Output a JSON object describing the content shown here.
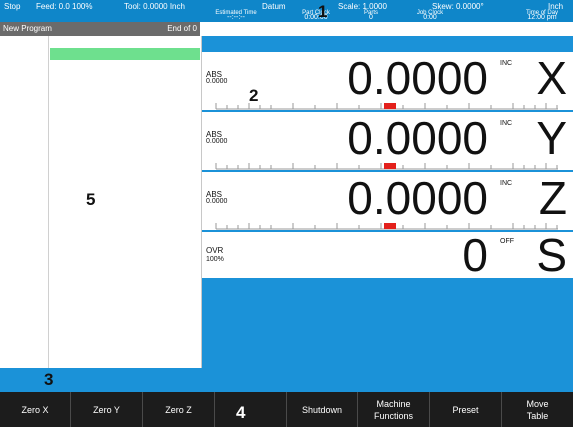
{
  "status_bar": {
    "state": "Stop",
    "feed": "Feed: 0.0 100%",
    "tool": "Tool: 0.0000 Inch",
    "datum": "Datum",
    "scale": "Scale: 1.0000",
    "skew": "Skew: 0.0000°",
    "units": "Inch",
    "clocks": [
      {
        "label": "Estimated Time",
        "value": "--:--:--"
      },
      {
        "label": "Part Clock",
        "value": "0:00:00"
      },
      {
        "label": "Parts",
        "value": "0"
      },
      {
        "label": "Job Clock",
        "value": "0:00"
      },
      {
        "label": "Time of Day",
        "value": "12:00 pm"
      }
    ]
  },
  "program": {
    "name": "New Program",
    "end": "End of 0"
  },
  "axes": [
    {
      "mode": "ABS",
      "mode_value": "0.0000",
      "readout": "0.0000",
      "inc": "INC",
      "letter": "X"
    },
    {
      "mode": "ABS",
      "mode_value": "0.0000",
      "readout": "0.0000",
      "inc": "INC",
      "letter": "Y"
    },
    {
      "mode": "ABS",
      "mode_value": "0.0000",
      "readout": "0.0000",
      "inc": "INC",
      "letter": "Z"
    }
  ],
  "spindle": {
    "mode": "OVR",
    "mode_value": "100%",
    "readout": "0",
    "state": "OFF",
    "letter": "S"
  },
  "softkeys": [
    {
      "label": "Zero X"
    },
    {
      "label": "Zero Y"
    },
    {
      "label": "Zero Z"
    },
    {
      "label": ""
    },
    {
      "label": "Shutdown"
    },
    {
      "label": "Machine\nFunctions"
    },
    {
      "label": "Preset"
    },
    {
      "label": "Move\nTable"
    }
  ],
  "callouts": [
    "1",
    "2",
    "3",
    "4",
    "5"
  ],
  "colors": {
    "status_bar": "#0f86c9",
    "dro_bg": "#1b92d8",
    "highlight": "#6ee08e",
    "marker": "#e3201b",
    "softkey_bar": "#1c1c1c"
  }
}
